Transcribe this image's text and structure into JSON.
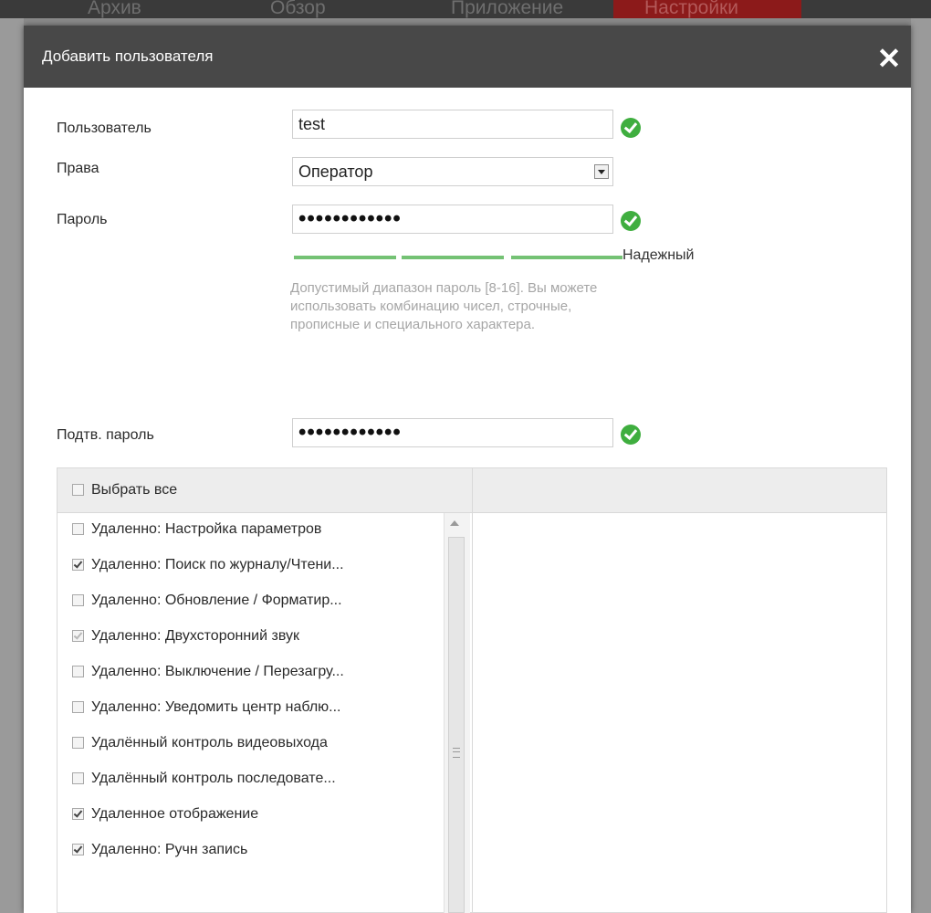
{
  "background": {
    "tabs": [
      "Архив",
      "Обзор",
      "Приложение",
      "Настройки"
    ],
    "active_tab_color": "#8c1a1a"
  },
  "dialog": {
    "title": "Добавить пользователя",
    "close_icon": "close-icon"
  },
  "form": {
    "user_label": "Пользователь",
    "user_value": "test",
    "rights_label": "Права",
    "rights_value": "Оператор",
    "password_label": "Пароль",
    "password_value": "••••••••••••",
    "strength_label": "Надежный",
    "strength_color": "#74c274",
    "hint": "Допустимый диапазон пароль [8-16]. Вы можете использовать комбинацию чисел, строчные, прописные и специального характера.",
    "confirm_label": "Подтв. пароль",
    "confirm_value": "••••••••••••",
    "ok_color": "#3fae3f"
  },
  "permissions": {
    "select_all_label": "Выбрать все",
    "items": [
      {
        "label": "Удаленно: Настройка параметров",
        "checked": false
      },
      {
        "label": "Удаленно: Поиск по журналу/Чтени...",
        "checked": true
      },
      {
        "label": "Удаленно: Обновление / Форматир...",
        "checked": false
      },
      {
        "label": "Удаленно: Двухсторонний звук",
        "checked": true
      },
      {
        "label": "Удаленно: Выключение / Перезагру...",
        "checked": false
      },
      {
        "label": "Удаленно: Уведомить центр наблю...",
        "checked": false
      },
      {
        "label": "Удалённый контроль видеовыхода",
        "checked": false
      },
      {
        "label": "Удалённый контроль последовате...",
        "checked": false
      },
      {
        "label": "Удаленное отображение",
        "checked": true
      },
      {
        "label": "Удаленно: Ручн запись",
        "checked": true
      }
    ]
  }
}
